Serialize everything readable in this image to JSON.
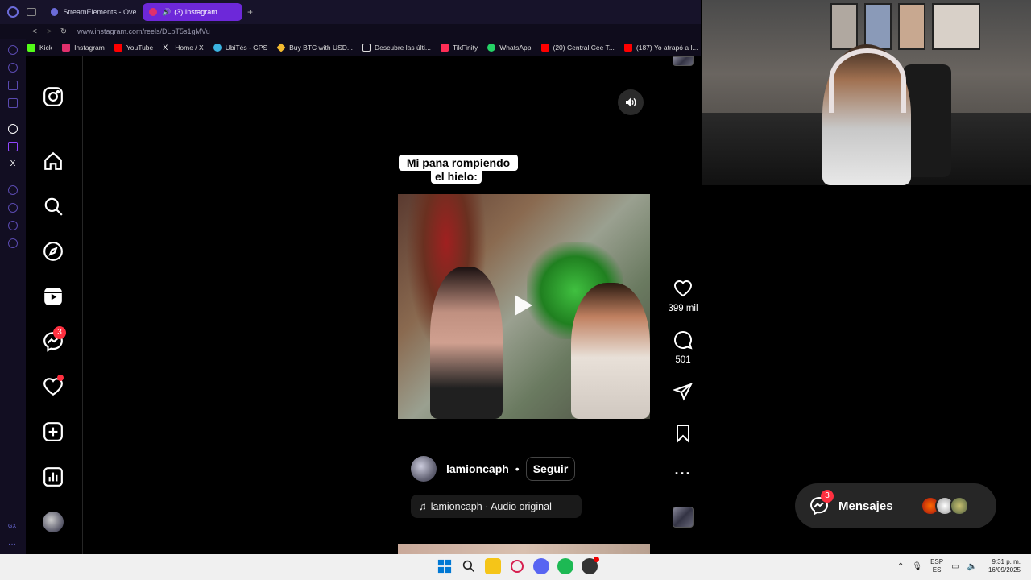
{
  "browser": {
    "tabs": [
      {
        "label": "StreamElements - Overlay",
        "active": false,
        "favicon_color": "#6b6bd8"
      },
      {
        "label": "(3) Instagram",
        "active": true,
        "favicon_color": "#e1306c"
      }
    ],
    "url": "www.instagram.com/reels/DLpT5s1gMVu",
    "bookmarks": [
      {
        "label": "Kick",
        "color": "#53fc18"
      },
      {
        "label": "Instagram",
        "color": "#e1306c"
      },
      {
        "label": "YouTube",
        "color": "#ff0000"
      },
      {
        "label": "Home / X",
        "color": "#ffffff"
      },
      {
        "label": "UbiTés - GPS",
        "color": "#3bb3e0"
      },
      {
        "label": "Buy BTC with USD...",
        "color": "#f3ba2f"
      },
      {
        "label": "Descubre las últi...",
        "color": "#dddddd"
      },
      {
        "label": "TikFinity",
        "color": "#ff2d55"
      },
      {
        "label": "WhatsApp",
        "color": "#25d366"
      },
      {
        "label": "(20) Central Cee T...",
        "color": "#ff0000"
      },
      {
        "label": "(187) Yo atrapó a l...",
        "color": "#ff0000"
      }
    ]
  },
  "sidebar": {
    "messages_badge": "3"
  },
  "reel": {
    "caption_line1": "Mi pana rompiendo",
    "caption_line2": "el hielo:",
    "author": "lamioncaph",
    "follow_label": "Seguir",
    "separator": "•",
    "audio": "lamioncaph · Audio original",
    "likes": "399 mil",
    "comments": "501"
  },
  "messages": {
    "label": "Mensajes",
    "badge": "3"
  },
  "taskbar": {
    "lang_top": "ESP",
    "lang_bottom": "ES",
    "time": "9:31 p. m.",
    "date": "16/09/2025"
  },
  "colors": {
    "accent": "#6d28d9",
    "badge": "#ff3040",
    "background": "#000000"
  }
}
